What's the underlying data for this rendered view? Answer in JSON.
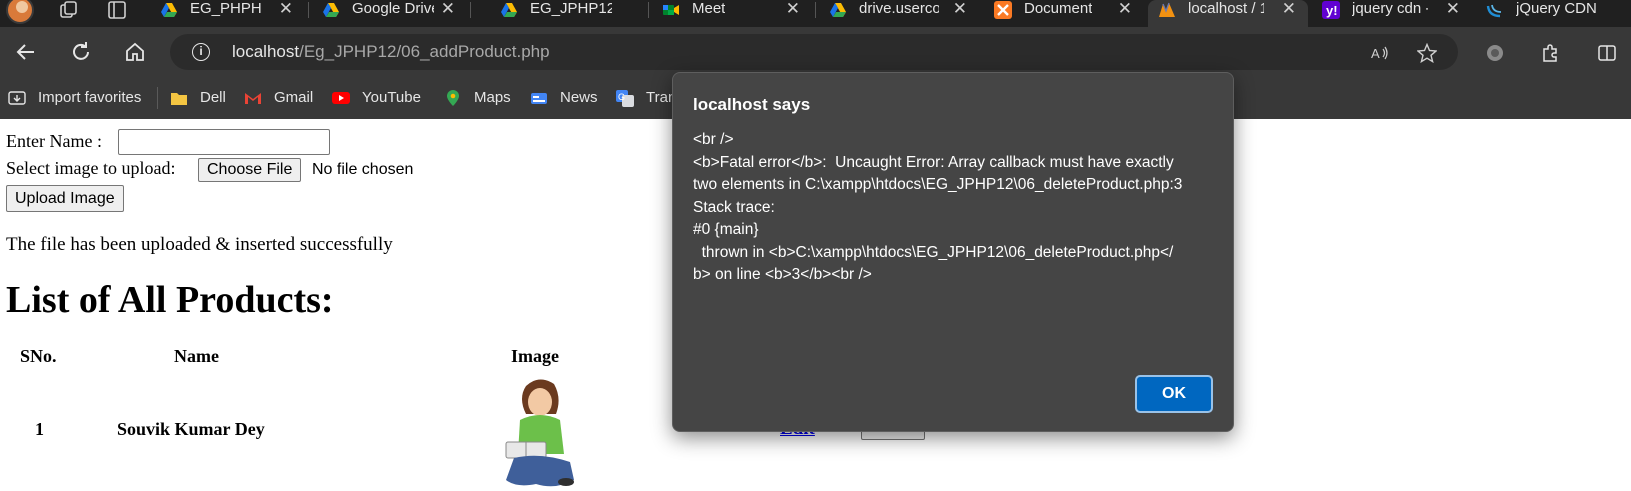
{
  "browser": {
    "tabs": [
      {
        "label": "EG_PHPH12",
        "icon": "google-drive-icon"
      },
      {
        "label": "Google Drive",
        "icon": "google-drive-icon"
      },
      {
        "label": "EG_JPHP12 (",
        "icon": "google-drive-icon"
      },
      {
        "label": "Meet",
        "icon": "google-meet-icon"
      },
      {
        "label": "drive.usercon",
        "icon": "google-drive-icon"
      },
      {
        "label": "Document",
        "icon": "xampp-icon"
      },
      {
        "label": "localhost / 1",
        "icon": "phpmyadmin-icon"
      },
      {
        "label": "jquery cdn -",
        "icon": "yahoo-icon"
      },
      {
        "label": "jQuery CDN",
        "icon": "jquery-icon"
      }
    ],
    "close_glyph": "✕",
    "url_host": "localhost",
    "url_path": "/Eg_JPHP12/06_addProduct.php",
    "bookmarks": [
      {
        "label": "Import favorites",
        "icon": "import-icon"
      },
      {
        "label": "Dell",
        "icon": "folder-icon"
      },
      {
        "label": "Gmail",
        "icon": "gmail-icon"
      },
      {
        "label": "YouTube",
        "icon": "youtube-icon"
      },
      {
        "label": "Maps",
        "icon": "maps-icon"
      },
      {
        "label": "News",
        "icon": "news-icon"
      },
      {
        "label": "Tran",
        "icon": "translate-icon"
      }
    ]
  },
  "page": {
    "name_label": "Enter Name :",
    "name_value": "",
    "image_label": "Select image to upload:",
    "choose_file_label": "Choose File",
    "no_file_text": "No file chosen",
    "upload_button_label": "Upload Image",
    "success_message": "The file has been uploaded & inserted successfully",
    "list_heading": "List of All Products:",
    "table": {
      "headers": [
        "SNo.",
        "Name",
        "Image"
      ],
      "rows": [
        {
          "sno": "1",
          "name": "Souvik Kumar Dey",
          "edit_label": "Edit",
          "delete_label": "Delete"
        }
      ]
    }
  },
  "dialog": {
    "title": "localhost says",
    "message": "<br />\n<b>Fatal error</b>:  Uncaught Error: Array callback must have exactly\ntwo elements in C:\\xampp\\htdocs\\EG_JPHP12\\06_deleteProduct.php:3\nStack trace:\n#0 {main}\n  thrown in <b>C:\\xampp\\htdocs\\EG_JPHP12\\06_deleteProduct.php</\nb> on line <b>3</b><br />",
    "ok_label": "OK"
  },
  "colors": {
    "tab_strip": "#202020",
    "toolbar": "#383838",
    "dialog_bg": "#454545",
    "ok_button": "#0067c0",
    "link": "#0000ee"
  }
}
